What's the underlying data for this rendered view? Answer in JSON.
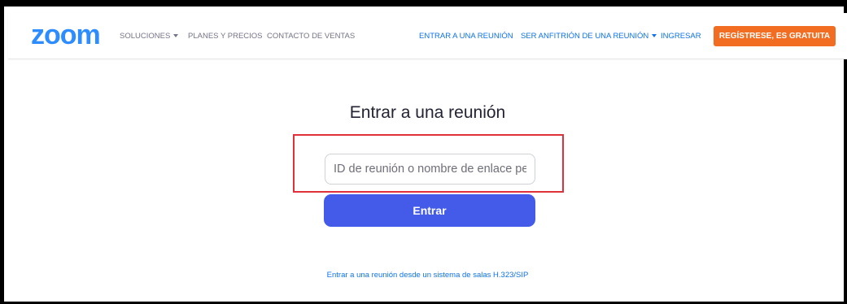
{
  "header": {
    "logo_text": "zoom",
    "nav": {
      "solutions": "SOLUCIONES",
      "plans": "PLANES Y PRECIOS",
      "contact_sales": "CONTACTO DE VENTAS",
      "join_meeting": "ENTRAR A UNA REUNIÓN",
      "host_meeting": "SER ANFITRIÓN DE UNA REUNIÓN",
      "sign_in": "INGRESAR",
      "sign_up": "REGÍSTRESE, ES GRATUITA"
    }
  },
  "main": {
    "title": "Entrar a una reunión",
    "input": {
      "placeholder": "ID de reunión o nombre de enlace personal",
      "value": ""
    },
    "join_button": "Entrar",
    "sip_link": "Entrar a una reunión desde un sistema de salas H.323/SIP"
  },
  "colors": {
    "brand": "#2d8cff",
    "link": "#0e72ed",
    "signup": "#f26d21",
    "join_button": "#445bea",
    "highlight": "#e0303a"
  }
}
